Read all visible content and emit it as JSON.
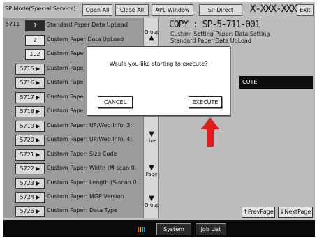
{
  "header": {
    "title": "SP Mode(Special Service)",
    "buttons": [
      "Open All",
      "Close All",
      "APL Window",
      "SP Direct"
    ],
    "model": "X-XXX-XXX",
    "exit_label": "Exit"
  },
  "list": {
    "top_code": "5711",
    "rows": [
      {
        "code": "1",
        "label": "Standard Paper Data UpLoad"
      },
      {
        "code": "2",
        "label": "Custom Paper Data UpLoad"
      },
      {
        "code": "102",
        "label": "Custom Pape"
      },
      {
        "code": "5715 ▶",
        "label": "Custom Pape"
      },
      {
        "code": "5716 ▶",
        "label": "Custom Pape"
      },
      {
        "code": "5717 ▶",
        "label": "Custom Pape"
      },
      {
        "code": "5718 ▶",
        "label": "Custom Pape"
      },
      {
        "code": "5719 ▶",
        "label": "Custom Paper: UP/Web Info. 3:"
      },
      {
        "code": "5720 ▶",
        "label": "Custom Paper: UP/Web Info. 4:"
      },
      {
        "code": "5721 ▶",
        "label": "Custom Paper: Size Code"
      },
      {
        "code": "5722 ▶",
        "label": "Custom Paper: Width (M-scan 0."
      },
      {
        "code": "5723 ▶",
        "label": "Custom Paper: Length (S-scan 0"
      },
      {
        "code": "5724 ▶",
        "label": "Custom Paper: MGP Version"
      },
      {
        "code": "5725 ▶",
        "label": "Custom Paper: Data Type"
      }
    ]
  },
  "scroll": {
    "group_top": "Group",
    "line": "Line",
    "page": "Page",
    "group_bottom": "Group"
  },
  "detail": {
    "title": "COPY : SP-5-711-001",
    "subtitle": "Custom Setting Paper: Data Setting",
    "subtitle2": "Standard Paper Data UpLoad",
    "selected": "CUTE",
    "prev_page": "PrevPage",
    "next_page": "NextPage"
  },
  "modal": {
    "message": "Would you like starting to execute?",
    "cancel": "CANCEL",
    "execute": "EXECUTE"
  },
  "footer": {
    "system_status": "System Status",
    "job_list": "Job List"
  },
  "colors": {
    "arrow": "#e31b1b",
    "status_icon": [
      "#e8423a",
      "#f2c12e",
      "#3aa35a",
      "#3a6fd8"
    ]
  }
}
